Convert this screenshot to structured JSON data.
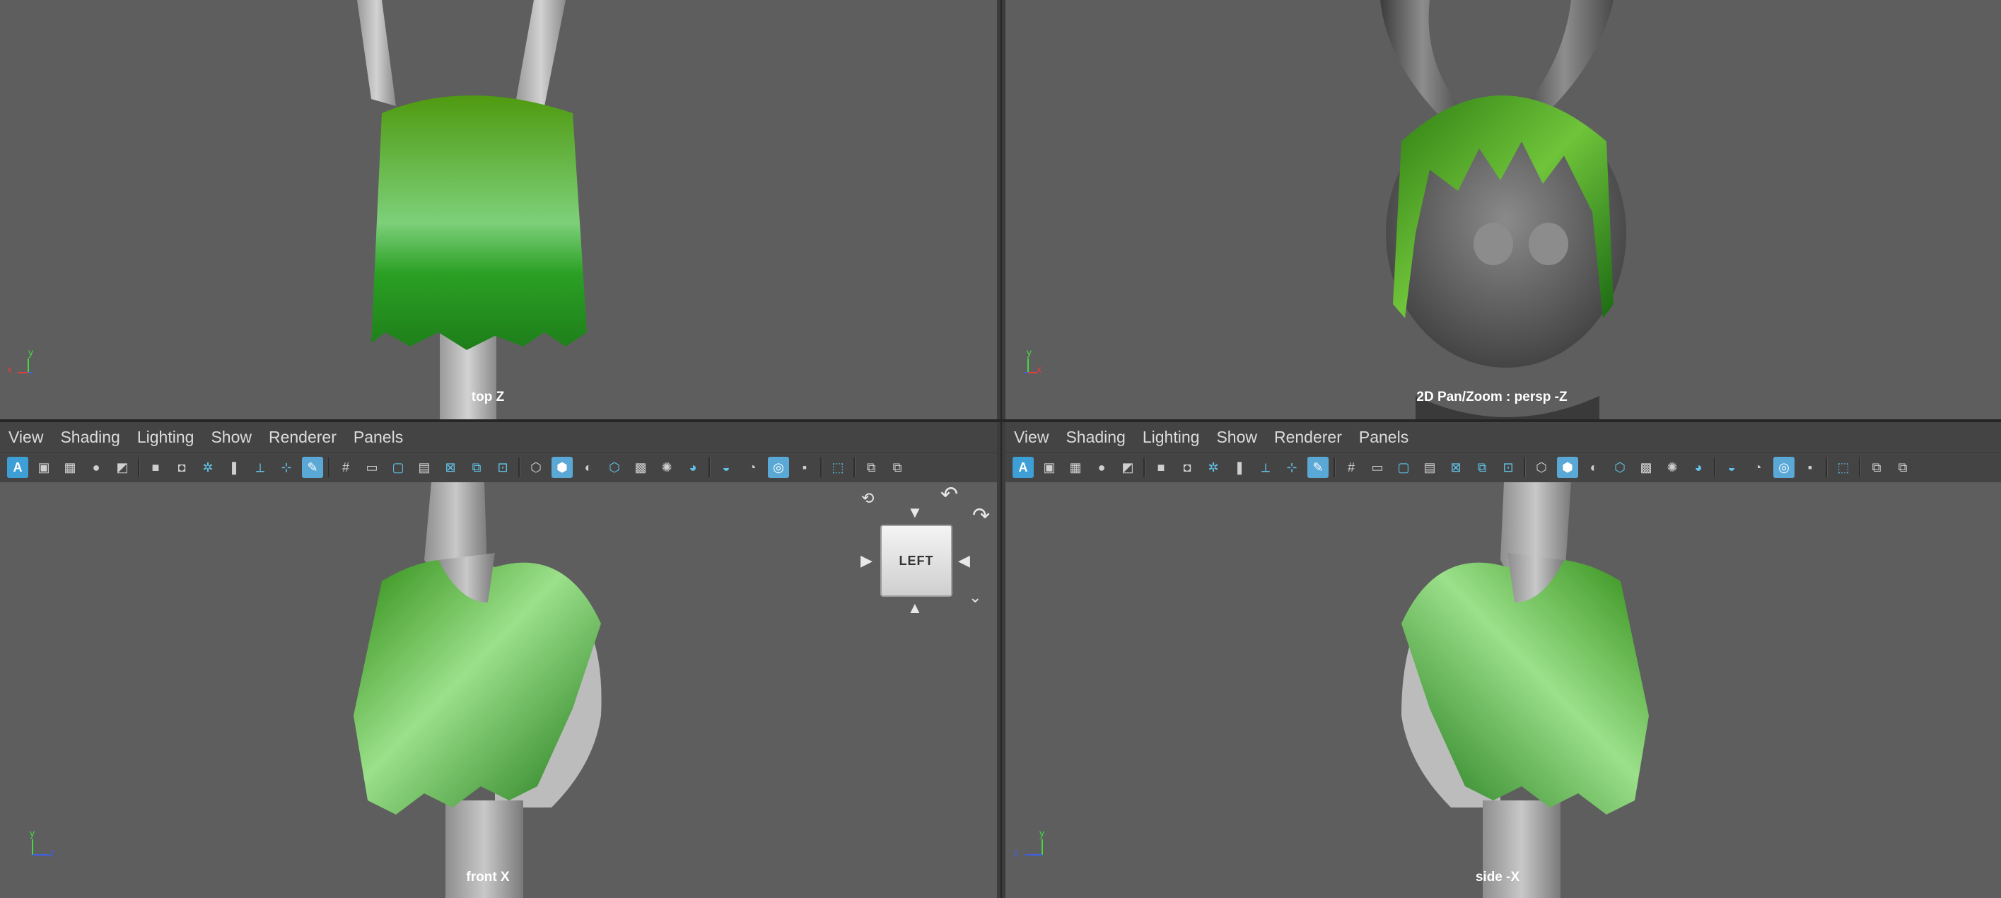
{
  "viewports": {
    "top_left": {
      "label": "top Z"
    },
    "top_right": {
      "label": "2D Pan/Zoom : persp -Z"
    },
    "bottom_left": {
      "label": "front X"
    },
    "bottom_right": {
      "label": "side -X"
    }
  },
  "panel_menu": [
    "View",
    "Shading",
    "Lighting",
    "Show",
    "Renderer",
    "Panels"
  ],
  "viewcube": {
    "label": "LEFT"
  },
  "axes": {
    "top_left": {
      "y": "y",
      "second": "x"
    },
    "top_right": {
      "y": "y",
      "second": "x"
    },
    "bottom_left": {
      "y": "y",
      "second": "z"
    },
    "bottom_right": {
      "y": "y",
      "second": "z"
    }
  },
  "toolbar_icons": [
    "select-all-icon",
    "camera-frame-icon",
    "grid-icon",
    "sphere-icon",
    "layers-icon",
    "camera-icon",
    "camera-lock-icon",
    "camera-settings-icon",
    "bookmark-icon",
    "isolate-icon",
    "pivot-icon",
    "paint-icon",
    "grid-toggle-icon",
    "film-gate-icon",
    "resolution-gate-icon",
    "safe-area-icon",
    "field-chart-icon",
    "image-plane-icon",
    "pan-zoom-icon",
    "hud-icon",
    "wireframe-cube-icon",
    "smooth-shade-icon",
    "flat-shade-icon",
    "wireframe-on-shaded-icon",
    "checker-icon",
    "light-icon",
    "shadow-icon",
    "ambient-occlusion-icon",
    "motion-blur-icon",
    "anti-alias-icon",
    "xray-icon",
    "isolate-select-icon",
    "panel-layout-icon",
    "panel-layout-2-icon"
  ],
  "colors": {
    "viewport_bg": "#5e5e5e",
    "hair_green": "#3fae1f",
    "model_gray": "#a9a9a9",
    "active_icon": "#5aa8d6"
  }
}
